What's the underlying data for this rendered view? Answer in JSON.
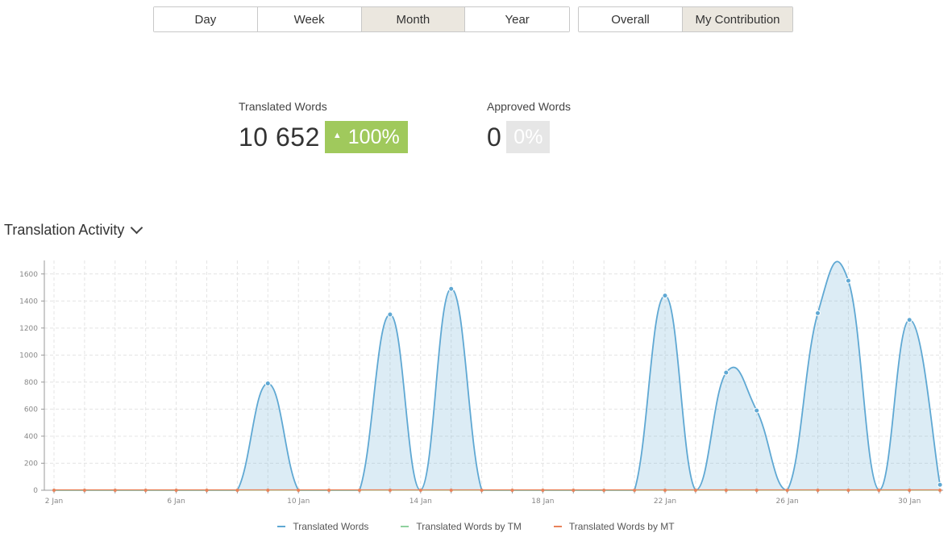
{
  "period_tabs": [
    {
      "label": "Day",
      "active": false
    },
    {
      "label": "Week",
      "active": false
    },
    {
      "label": "Month",
      "active": true
    },
    {
      "label": "Year",
      "active": false
    }
  ],
  "scope_tabs": [
    {
      "label": "Overall",
      "active": false
    },
    {
      "label": "My Contribution",
      "active": true
    }
  ],
  "stats": {
    "translated": {
      "label": "Translated Words",
      "value": "10 652",
      "change": "100%",
      "arrow_icon": "triangle-up"
    },
    "approved": {
      "label": "Approved Words",
      "value": "0",
      "change": "0%"
    }
  },
  "section": {
    "title": "Translation Activity",
    "icon": "chevron-down-icon"
  },
  "colors": {
    "translated": "#5fa8d3",
    "tm": "#8fd19e",
    "mt": "#e8825a",
    "badge_green": "#a0c95c",
    "active_tab": "#ebe7df"
  },
  "chart_data": {
    "type": "area",
    "title": "",
    "xlabel": "",
    "ylabel": "",
    "ylim": [
      0,
      1700
    ],
    "yticks": [
      0,
      200,
      400,
      600,
      800,
      1000,
      1200,
      1400,
      1600
    ],
    "grid": true,
    "legend_position": "bottom-center",
    "x": [
      2,
      3,
      4,
      5,
      6,
      7,
      8,
      9,
      10,
      11,
      12,
      13,
      14,
      15,
      16,
      17,
      18,
      19,
      20,
      21,
      22,
      23,
      24,
      25,
      26,
      27,
      28,
      29,
      30,
      31
    ],
    "x_labels": [
      {
        "x": 2,
        "label": "2 Jan"
      },
      {
        "x": 6,
        "label": "6 Jan"
      },
      {
        "x": 10,
        "label": "10 Jan"
      },
      {
        "x": 14,
        "label": "14 Jan"
      },
      {
        "x": 18,
        "label": "18 Jan"
      },
      {
        "x": 22,
        "label": "22 Jan"
      },
      {
        "x": 26,
        "label": "26 Jan"
      },
      {
        "x": 30,
        "label": "30 Jan"
      }
    ],
    "series": [
      {
        "name": "Translated Words",
        "values": [
          0,
          0,
          0,
          0,
          0,
          0,
          0,
          790,
          0,
          0,
          0,
          1300,
          0,
          1490,
          0,
          0,
          0,
          0,
          0,
          0,
          1440,
          0,
          870,
          590,
          0,
          1310,
          1550,
          0,
          1260,
          40
        ]
      },
      {
        "name": "Translated Words by TM",
        "values": [
          0,
          0,
          0,
          0,
          0,
          0,
          0,
          0,
          0,
          0,
          0,
          0,
          0,
          0,
          0,
          0,
          0,
          0,
          0,
          0,
          0,
          0,
          0,
          0,
          0,
          0,
          0,
          0,
          0,
          0
        ]
      },
      {
        "name": "Translated Words by MT",
        "values": [
          0,
          0,
          0,
          0,
          0,
          0,
          0,
          0,
          0,
          0,
          0,
          0,
          0,
          0,
          0,
          0,
          0,
          0,
          0,
          0,
          0,
          0,
          0,
          0,
          0,
          0,
          0,
          0,
          0,
          0
        ]
      }
    ]
  }
}
